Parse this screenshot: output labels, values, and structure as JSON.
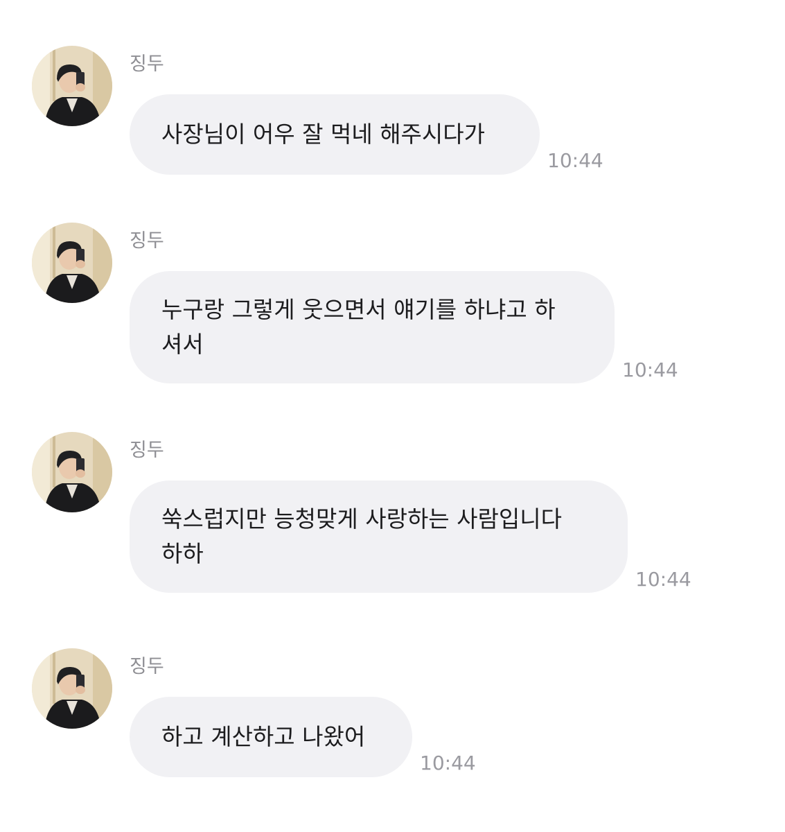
{
  "messages": [
    {
      "sender": "징두",
      "text": "사장님이 어우 잘 먹네 해주시다가",
      "time": "10:44"
    },
    {
      "sender": "징두",
      "text": "누구랑 그렇게 웃으면서 얘기를 하냐고 하\n셔서",
      "time": "10:44"
    },
    {
      "sender": "징두",
      "text": "쑥스럽지만 능청맞게 사랑하는 사람입니다\n하하",
      "time": "10:44"
    },
    {
      "sender": "징두",
      "text": "하고 계산하고 나왔어",
      "time": "10:44"
    }
  ],
  "colors": {
    "bubble": "#f1f1f4",
    "text": "#1c1c1e",
    "sender": "#8e8e93",
    "time": "#9a9aa0"
  },
  "icons": {
    "avatar": "profile-photo-avatar-icon"
  }
}
